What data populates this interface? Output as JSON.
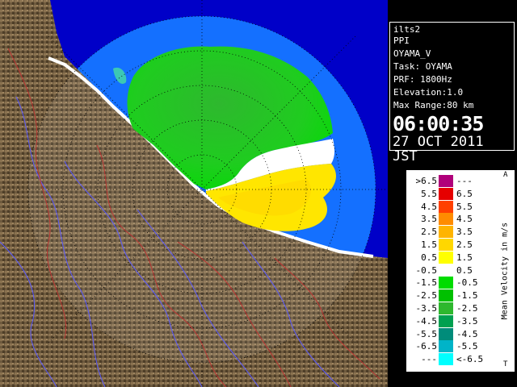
{
  "info": {
    "lines": [
      "ilts2",
      "PPI",
      "OYAMA_V",
      "Task: OYAMA",
      "PRF: 1800Hz",
      "Elevation:1.0",
      "Max Range:80 km"
    ],
    "time": "06:00:35",
    "date": "27 OCT 2011 JST"
  },
  "legend": {
    "title": "Mean Velocity in m/s",
    "corner_top": "A",
    "corner_bottom": "T",
    "rows": [
      {
        "left": ">6.5",
        "right": "---",
        "color": "#b0007a"
      },
      {
        "left": "5.5",
        "right": "6.5",
        "color": "#e60000"
      },
      {
        "left": "4.5",
        "right": "5.5",
        "color": "#ff4000"
      },
      {
        "left": "3.5",
        "right": "4.5",
        "color": "#ff8c00"
      },
      {
        "left": "2.5",
        "right": "3.5",
        "color": "#ffb400"
      },
      {
        "left": "1.5",
        "right": "2.5",
        "color": "#ffd700"
      },
      {
        "left": "0.5",
        "right": "1.5",
        "color": "#ffff00"
      },
      {
        "left": "-0.5",
        "right": "0.5",
        "color": "#ffffff"
      },
      {
        "left": "-1.5",
        "right": "-0.5",
        "color": "#00dc00"
      },
      {
        "left": "-2.5",
        "right": "-1.5",
        "color": "#00c000"
      },
      {
        "left": "-3.5",
        "right": "-2.5",
        "color": "#2eb82e"
      },
      {
        "left": "-4.5",
        "right": "-3.5",
        "color": "#00a050"
      },
      {
        "left": "-5.5",
        "right": "-4.5",
        "color": "#008c7a"
      },
      {
        "left": "-6.5",
        "right": "-5.5",
        "color": "#00b4c8"
      },
      {
        "left": "---",
        "right": "<-6.5",
        "color": "#00ffff"
      }
    ]
  },
  "colors": {
    "sea": "#0064ff",
    "range_ring": "#4a90ff",
    "outside": "#0000c8",
    "terrain": "#6e5a3e"
  }
}
